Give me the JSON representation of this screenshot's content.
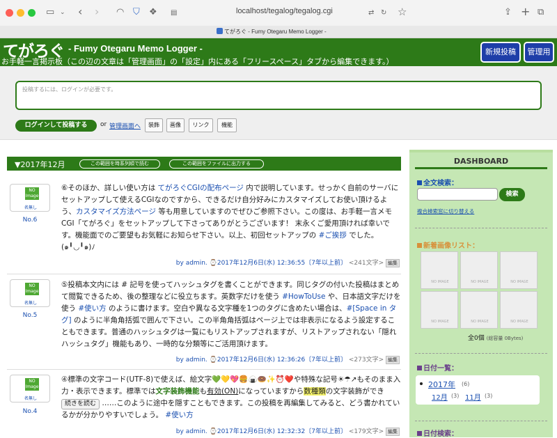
{
  "browser": {
    "url": "localhost/tegalog/tegalog.cgi",
    "tab_title": "てがろぐ - Fumy Otegaru Memo Logger -"
  },
  "header": {
    "title": "てがろぐ",
    "subtitle": "- Fumy Otegaru Memo Logger -",
    "description": "お手軽一言掲示板（この辺の文章は「管理画面」の「設定」内にある「フリースペース」タブから編集できます。）",
    "new_post_label": "新規投稿",
    "admin_label": "管理用"
  },
  "post_form": {
    "placeholder": "投稿するには、ログインが必要です。",
    "login_button": "ログインして投稿する",
    "or_text": "or",
    "admin_link": "管理画面へ",
    "tools": [
      "装飾",
      "画像",
      "リンク",
      "機能"
    ]
  },
  "month": {
    "label": "▼2017年12月",
    "chrono_label": "この範囲を時系列順で読む",
    "export_label": "この範囲をファイルに出力する"
  },
  "posts": [
    {
      "no": "No.6",
      "avatar_text": "NO Image",
      "name": "名無し",
      "text_a": "⑥そのほか、詳しい使い方は ",
      "link_a": "てがろぐCGIの配布ページ",
      "text_b": " 内で説明しています。せっかく自前のサーバにセットアップして使えるCGIなのですから、できるだけ自分好みにカスタマイズしてお使い頂けるよう、",
      "link_b": "カスタマイズ方法ページ",
      "text_c": " 等も用意していますのでぜひご参照下さい。この度は、お手軽一言メモCGI「てがろぐ」をセットアップして下さってありがとうございます！ 末永くご愛用頂ければ幸いです。機能面でのご要望もお気軽にお知らせ下さい。以上、初回セットアップの ",
      "tag": "#ご挨拶",
      "text_d": " でした。(๑╹◡╹๑)ﾉ",
      "by": "by admin.",
      "date": "2017年12月6日(水) 12:36:55〔7年以上前〕",
      "count": "<241文字>",
      "edit": "編集"
    },
    {
      "no": "No.5",
      "avatar_text": "NO Image",
      "name": "名無し",
      "text_a": "⑤投稿本文内には # 記号を使ってハッシュタグを書くことができます。同じタグの付いた投稿はまとめて閲覧できるため、後の整理などに役立ちます。英数字だけを使う ",
      "tag_a": "#HowToUse",
      "text_b": " や、日本語文字だけを使う ",
      "tag_b": "#使い方",
      "text_c": " のように書けます。空白や異なる文字種を1つのタグに含めたい場合は、",
      "tag_c": "#[Space in タグ]",
      "text_d": " のように半角角括弧で囲んで下さい。この半角角括弧はページ上では非表示になるよう設定することもできます。普通のハッシュタグは一覧にもリストアップされますが、リストアップされない「隠れハッシュタグ」機能もあり、一時的な分類等にご活用頂けます。",
      "by": "by admin.",
      "date": "2017年12月6日(水) 12:36:26〔7年以上前〕",
      "count": "<273文字>",
      "edit": "編集"
    },
    {
      "no": "No.4",
      "avatar_text": "NO Image",
      "name": "名無し",
      "text_a": "④標準の文字コード(UTF-8)で使えば、絵文字💚💛💖🍔🍙🍩✨⏰❤️や特殊な記号☀☂↗もそのまま入力・表示できます。標準では",
      "deco_a": "文字装飾機能",
      "text_b": "も",
      "deco_b": "有効(ON)",
      "text_c": "になっていますから",
      "deco_c": "数種類",
      "text_d": "の文字装飾ができ",
      "readmore": "続きを読む",
      "text_e": " ……このように途中を隠すこともできます。この投稿を再編集してみると、どう書かれているかが分かりやすいでしょう。 ",
      "tag": "#使い方",
      "by": "by admin.",
      "date": "2017年12月6日(水) 12:32:32〔7年以上前〕",
      "count": "<179文字>",
      "edit": "編集"
    }
  ],
  "sidebar": {
    "title": "DASHBOARD",
    "search_heading": "全文検索：",
    "search_button": "検索",
    "advanced_link": "複合検索窓に切り替える",
    "images_heading": "新着画像リスト：",
    "no_image": "NO IMAGE",
    "image_count": "全0個",
    "image_size": "(総容量 0Bytes)",
    "dates_heading": "日付一覧：",
    "year": "2017年",
    "year_count": "(6)",
    "months": [
      {
        "label": "12月",
        "count": "(3)"
      },
      {
        "label": "11月",
        "count": "(3)"
      }
    ],
    "date_search_heading": "日付検索："
  }
}
